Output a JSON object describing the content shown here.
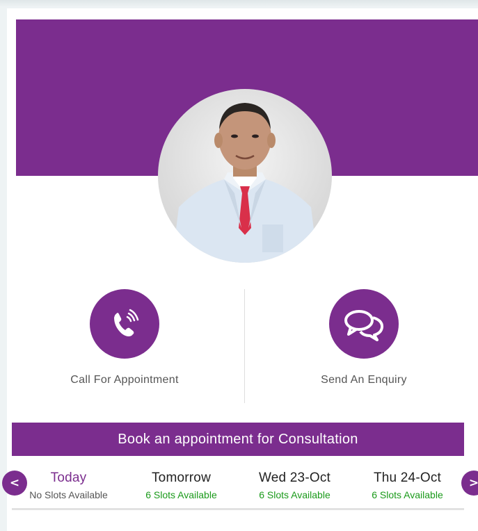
{
  "actions": {
    "call_label": "Call For Appointment",
    "call_icon": "phone-icon",
    "enquiry_label": "Send An Enquiry",
    "enquiry_icon": "chat-bubbles-icon"
  },
  "booking": {
    "title": "Book an appointment for Consultation",
    "prev_label": "<",
    "next_label": ">",
    "days": [
      {
        "label": "Today",
        "availability": "No Slots Available"
      },
      {
        "label": "Tomorrow",
        "availability": "6 Slots Available"
      },
      {
        "label": "Wed 23-Oct",
        "availability": "6 Slots Available"
      },
      {
        "label": "Thu 24-Oct",
        "availability": "6 Slots Available"
      }
    ]
  },
  "colors": {
    "brand": "#7b2d8e",
    "available": "#1a9a1a"
  }
}
